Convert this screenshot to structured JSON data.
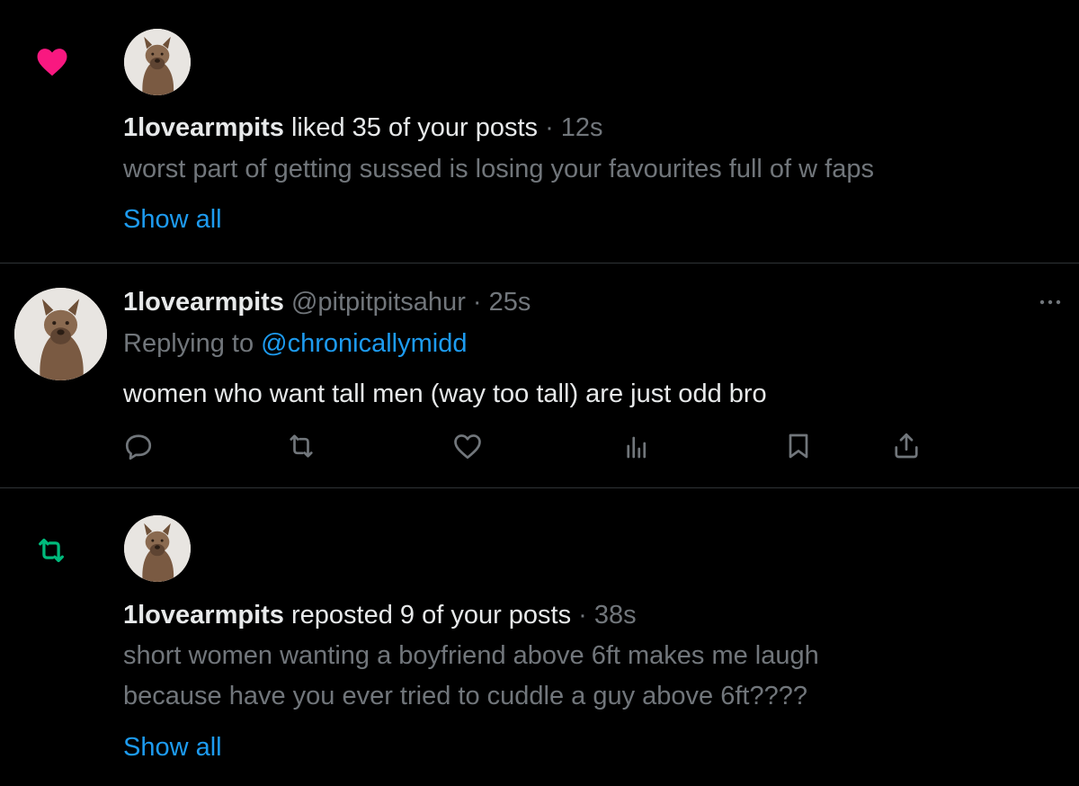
{
  "colors": {
    "background": "#000000",
    "text_primary": "#e7e9ea",
    "text_secondary": "#71767b",
    "accent_blue": "#1d9bf0",
    "like_pink": "#f91880",
    "repost_green": "#00ba7c",
    "divider": "#2f3336"
  },
  "notifications": [
    {
      "type": "like",
      "icon": "heart-icon",
      "username": "1lovearmpits",
      "action_text": " liked 35 of your posts",
      "time": " · 12s",
      "post_text": "worst part of getting sussed is losing your favourites full of w faps",
      "show_all_label": "Show all"
    },
    {
      "type": "reply",
      "username": "1lovearmpits",
      "handle": " @pitpitpitsahur",
      "time": " · 25s",
      "replying_prefix": "Replying to ",
      "replying_to": "@chronicallymidd",
      "post_text": "women who want tall men (way too tall) are just odd bro",
      "actions": [
        "reply-icon",
        "repost-icon",
        "like-icon",
        "views-icon",
        "bookmark-icon",
        "share-icon"
      ]
    },
    {
      "type": "repost",
      "icon": "repost-icon",
      "username": "1lovearmpits",
      "action_text": " reposted 9 of your posts",
      "time": " · 38s",
      "post_text_line1": "short women wanting a boyfriend above 6ft makes me laugh",
      "post_text_line2": "because have you ever tried to cuddle a guy above 6ft????",
      "show_all_label": "Show all"
    }
  ]
}
